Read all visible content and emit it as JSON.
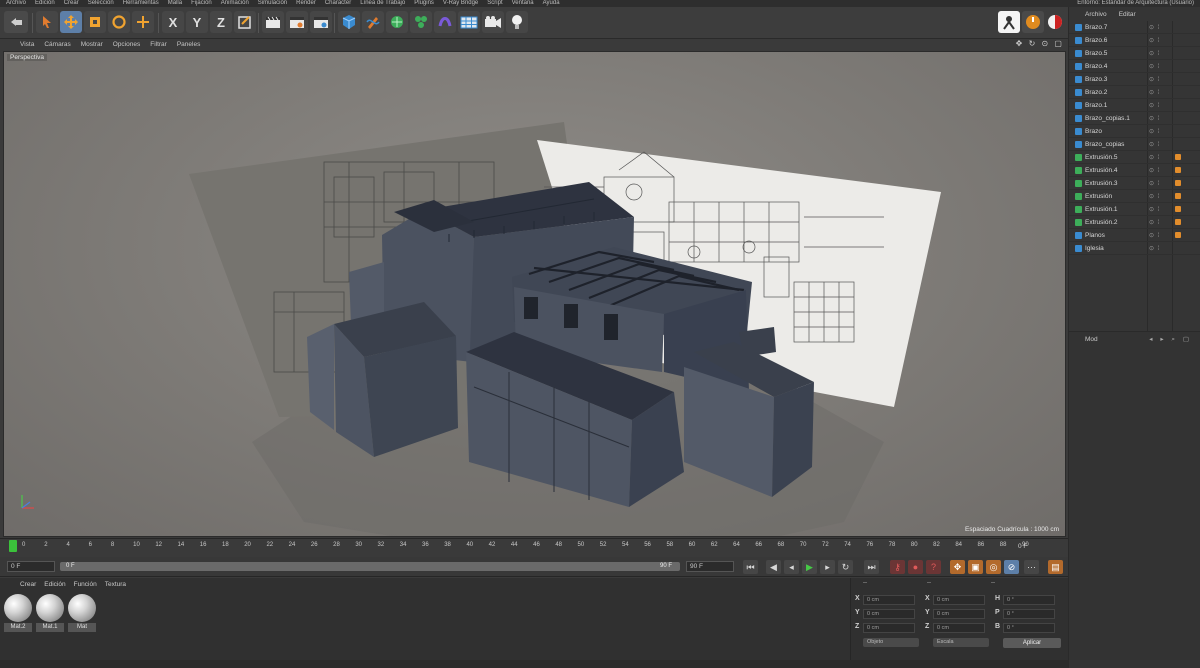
{
  "menu": [
    "Archivo",
    "Edición",
    "Crear",
    "Selección",
    "Herramientas",
    "Malla",
    "Fijación",
    "Animación",
    "Simulación",
    "Render",
    "Character",
    "Línea de Trabajo",
    "Plugins",
    "V-Ray Bridge",
    "Script",
    "Ventana",
    "Ayuda"
  ],
  "entorno": "Entorno: Estándar de Arquitectura (Usuario)",
  "viewport_menu": [
    "Vista",
    "Cámaras",
    "Mostrar",
    "Opciones",
    "Filtrar",
    "Paneles"
  ],
  "viewport": {
    "label": "Perspectiva",
    "grid_spacing": "Espaciado Cuadrícula : 1000 cm"
  },
  "objects": {
    "menu": [
      "Archivo",
      "Editar"
    ],
    "items": [
      {
        "label": "Brazo.7",
        "type": "blue"
      },
      {
        "label": "Brazo.6",
        "type": "blue"
      },
      {
        "label": "Brazo.5",
        "type": "blue"
      },
      {
        "label": "Brazo.4",
        "type": "blue"
      },
      {
        "label": "Brazo.3",
        "type": "blue"
      },
      {
        "label": "Brazo.2",
        "type": "blue"
      },
      {
        "label": "Brazo.1",
        "type": "blue"
      },
      {
        "label": "Brazo_copias.1",
        "type": "blue"
      },
      {
        "label": "Brazo",
        "type": "blue"
      },
      {
        "label": "Brazo_copias",
        "type": "blue"
      },
      {
        "label": "Extrusión.5",
        "type": "green"
      },
      {
        "label": "Extrusión.4",
        "type": "green"
      },
      {
        "label": "Extrusión.3",
        "type": "green"
      },
      {
        "label": "Extrusión",
        "type": "green"
      },
      {
        "label": "Extrusión.1",
        "type": "green"
      },
      {
        "label": "Extrusión.2",
        "type": "green"
      },
      {
        "label": "Planos",
        "type": "blue"
      },
      {
        "label": "Iglesia",
        "type": "blue"
      }
    ]
  },
  "attributes": {
    "tab": "Mod"
  },
  "timeline": {
    "ticks": [
      "0",
      "2",
      "4",
      "6",
      "8",
      "10",
      "12",
      "14",
      "16",
      "18",
      "20",
      "22",
      "24",
      "26",
      "28",
      "30",
      "32",
      "34",
      "36",
      "38",
      "40",
      "42",
      "44",
      "46",
      "48",
      "50",
      "52",
      "54",
      "56",
      "58",
      "60",
      "62",
      "64",
      "66",
      "68",
      "70",
      "72",
      "74",
      "76",
      "78",
      "80",
      "82",
      "84",
      "86",
      "88",
      "90"
    ],
    "end_label": "0 F"
  },
  "transport": {
    "current_frame": "0 F",
    "slider_left": "0 F",
    "slider_right": "90 F",
    "end_frame": "90 F"
  },
  "materials": {
    "menu": [
      "Crear",
      "Edición",
      "Función",
      "Textura"
    ],
    "items": [
      "Mat.2",
      "Mat.1",
      "Mat"
    ]
  },
  "coordinates": {
    "headers": [
      "--",
      "--",
      "--"
    ],
    "rows": [
      {
        "a": "X",
        "av": "0 cm",
        "b": "X",
        "bv": "0 cm",
        "c": "H",
        "cv": "0 °"
      },
      {
        "a": "Y",
        "av": "0 cm",
        "b": "Y",
        "bv": "0 cm",
        "c": "P",
        "cv": "0 °"
      },
      {
        "a": "Z",
        "av": "0 cm",
        "b": "Z",
        "bv": "0 cm",
        "c": "B",
        "cv": "0 °"
      }
    ],
    "mode": "Objeto",
    "size_mode": "Escala",
    "apply": "Aplicar"
  },
  "colors": {
    "accent": "#5d7fa8",
    "timeline_marker": "#3bc23b",
    "key_orange": "#e28d2c"
  }
}
